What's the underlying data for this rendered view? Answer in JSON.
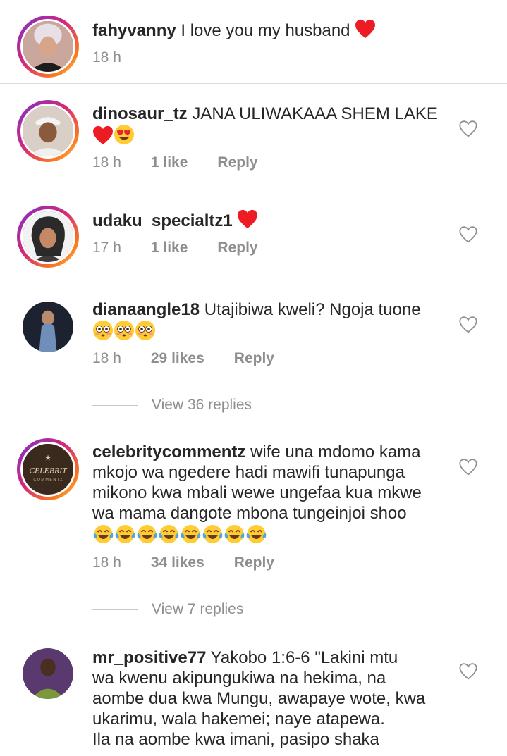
{
  "caption": {
    "username": "fahyvanny",
    "text": "I love you my husband",
    "emoji": "red-heart",
    "time": "18 h"
  },
  "comments": [
    {
      "username": "dinosaur_tz",
      "text": "JANA ULIWAKAAA SHEM LAKE",
      "emoji": "red-heart, heart-eyes-face",
      "time": "18 h",
      "likes": "1 like",
      "reply": "Reply"
    },
    {
      "username": "udaku_specialtz1",
      "text": "",
      "emoji": "red-heart",
      "time": "17 h",
      "likes": "1 like",
      "reply": "Reply"
    },
    {
      "username": "dianaangle18",
      "text": "Utajibiwa kweli? Ngoja tuone",
      "emoji": "flushed-face x3",
      "time": "18 h",
      "likes": "29 likes",
      "reply": "Reply",
      "view_replies": "View 36 replies"
    },
    {
      "username": "celebritycommentz",
      "line1": "wife una mdomo kama",
      "line2": "mkojo wa ngedere  hadi mawifi tunapunga",
      "line3": "mikono kwa mbali wewe ungefaa kua mkwe",
      "line4": "wa mama dangote mbona tungeinjoi shoo",
      "emoji": "tears-of-joy x8",
      "time": "18 h",
      "likes": "34 likes",
      "reply": "Reply",
      "view_replies": "View 7 replies",
      "avatar_text": "CELEBRIT"
    },
    {
      "username": "mr_positive77",
      "line1": "Yakobo 1:6-6 \"Lakini mtu",
      "line2": "wa kwenu akipungukiwa na hekima, na",
      "line3": "aombe dua kwa Mungu, awapaye wote, kwa",
      "line4": "ukarimu, wala hakemei; naye atapewa.",
      "line5": "Ila na aombe kwa imani, pasipo shaka"
    }
  ],
  "colors": {
    "text": "#262626",
    "meta": "#8e8e8e",
    "heart": "#ed1c24",
    "story_ring": "#d62976"
  }
}
